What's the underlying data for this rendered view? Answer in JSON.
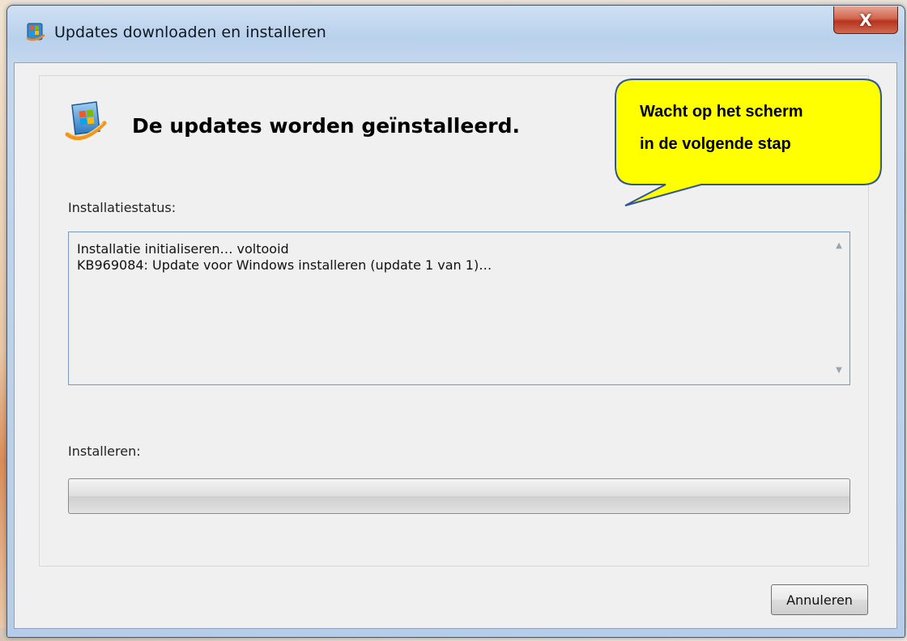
{
  "window": {
    "title": "Updates downloaden en installeren",
    "close_glyph": "X"
  },
  "header": {
    "title": "De updates worden geïnstalleerd."
  },
  "status": {
    "label": "Installatiestatus:",
    "lines": [
      "Installatie initialiseren… voltooid",
      "KB969084: Update voor Windows installeren (update 1 van 1)…"
    ]
  },
  "progress": {
    "label": "Installeren:",
    "fraction": 0
  },
  "buttons": {
    "cancel_label": "Annuleren"
  },
  "callout": {
    "line1": "Wacht op het scherm",
    "line2": "in de volgende stap",
    "fill_color": "#ffff00",
    "border_color": "#2f5597"
  },
  "icons": {
    "window_icon": "windows-update-icon",
    "header_icon": "windows-update-icon",
    "scroll_up": "chevron-up-icon",
    "scroll_down": "chevron-down-icon"
  }
}
